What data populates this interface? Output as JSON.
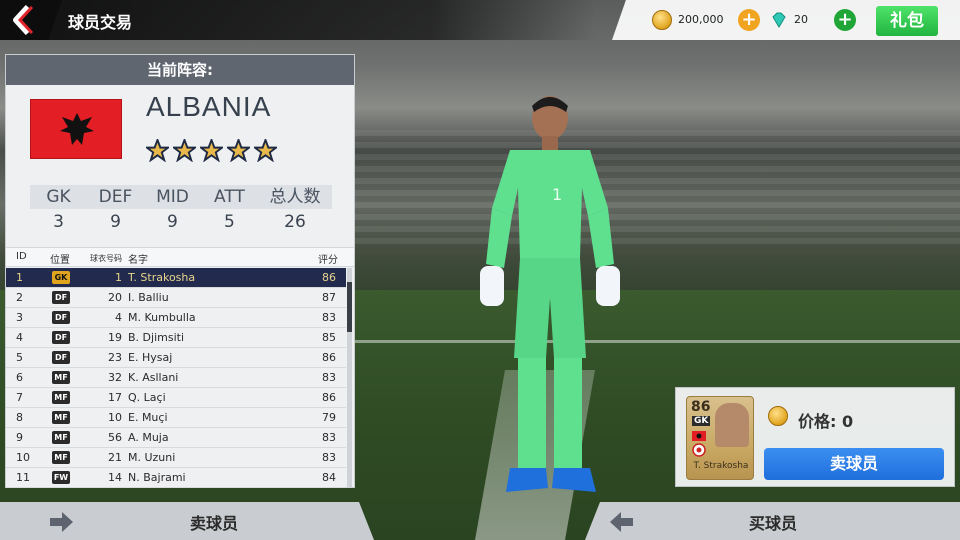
{
  "header": {
    "title": "球员交易",
    "coins": "200,000",
    "gems": "20",
    "gift_label": "礼包"
  },
  "lineup": {
    "heading": "当前阵容:",
    "team_name": "ALBANIA",
    "stars": 5,
    "positions": {
      "headers": [
        "GK",
        "DEF",
        "MID",
        "ATT",
        "总人数"
      ],
      "values": [
        "3",
        "9",
        "9",
        "5",
        "26"
      ]
    },
    "list_headers": {
      "id": "ID",
      "position": "位置",
      "number": "球衣号码",
      "name": "名字",
      "rating": "评分"
    },
    "players": [
      {
        "id": "1",
        "pos": "GK",
        "num": "1",
        "name": "T. Strakosha",
        "rating": "86",
        "selected": true
      },
      {
        "id": "2",
        "pos": "DF",
        "num": "20",
        "name": "I. Balliu",
        "rating": "87"
      },
      {
        "id": "3",
        "pos": "DF",
        "num": "4",
        "name": "M. Kumbulla",
        "rating": "83"
      },
      {
        "id": "4",
        "pos": "DF",
        "num": "19",
        "name": "B. Djimsiti",
        "rating": "85"
      },
      {
        "id": "5",
        "pos": "DF",
        "num": "23",
        "name": "E. Hysaj",
        "rating": "86"
      },
      {
        "id": "6",
        "pos": "MF",
        "num": "32",
        "name": "K. Asllani",
        "rating": "83"
      },
      {
        "id": "7",
        "pos": "MF",
        "num": "17",
        "name": "Q. Laçi",
        "rating": "86"
      },
      {
        "id": "8",
        "pos": "MF",
        "num": "10",
        "name": "E. Muçi",
        "rating": "79"
      },
      {
        "id": "9",
        "pos": "MF",
        "num": "56",
        "name": "A. Muja",
        "rating": "83"
      },
      {
        "id": "10",
        "pos": "MF",
        "num": "21",
        "name": "M. Uzuni",
        "rating": "83"
      },
      {
        "id": "11",
        "pos": "FW",
        "num": "14",
        "name": "N. Bajrami",
        "rating": "84"
      }
    ]
  },
  "pos_colors": {
    "GK": "#e0a41e",
    "DF": "#2b2b2b",
    "MF": "#2b2b2b",
    "FW": "#2b2b2b"
  },
  "selected_card": {
    "rating": "86",
    "position": "GK",
    "name": "T. Strakosha",
    "price_label": "价格: 0",
    "sell_label": "卖球员"
  },
  "bottom": {
    "sell_label": "卖球员",
    "buy_label": "买球员"
  }
}
